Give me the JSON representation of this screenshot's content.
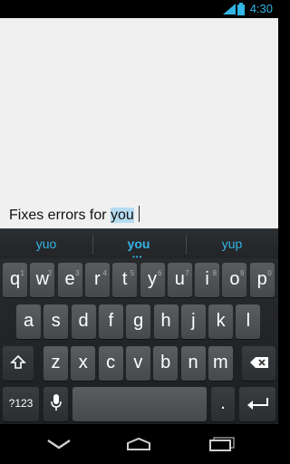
{
  "status": {
    "time": "4:30"
  },
  "editor": {
    "text_before": "Fixes errors for ",
    "highlighted_word": "you"
  },
  "suggestions": {
    "left": "yuo",
    "center": "you",
    "right": "yup",
    "more_indicator": "•••"
  },
  "keyboard": {
    "row1": [
      {
        "label": "q",
        "hint": "1"
      },
      {
        "label": "w",
        "hint": "2"
      },
      {
        "label": "e",
        "hint": "3"
      },
      {
        "label": "r",
        "hint": "4"
      },
      {
        "label": "t",
        "hint": "5"
      },
      {
        "label": "y",
        "hint": "6"
      },
      {
        "label": "u",
        "hint": "7"
      },
      {
        "label": "i",
        "hint": "8"
      },
      {
        "label": "o",
        "hint": "9"
      },
      {
        "label": "p",
        "hint": "0"
      }
    ],
    "row2": [
      "a",
      "s",
      "d",
      "f",
      "g",
      "h",
      "j",
      "k",
      "l"
    ],
    "row3": [
      "z",
      "x",
      "c",
      "v",
      "b",
      "n",
      "m"
    ],
    "symbols_label": "?123",
    "period_label": "."
  },
  "icons": {
    "shift": "shift-icon",
    "delete": "backspace-icon",
    "mic": "microphone-icon",
    "enter": "enter-icon",
    "back": "back-icon",
    "home": "home-icon",
    "recents": "recent-apps-icon"
  },
  "colors": {
    "accent": "#33b5e5",
    "highlight": "#b6dcf2"
  }
}
